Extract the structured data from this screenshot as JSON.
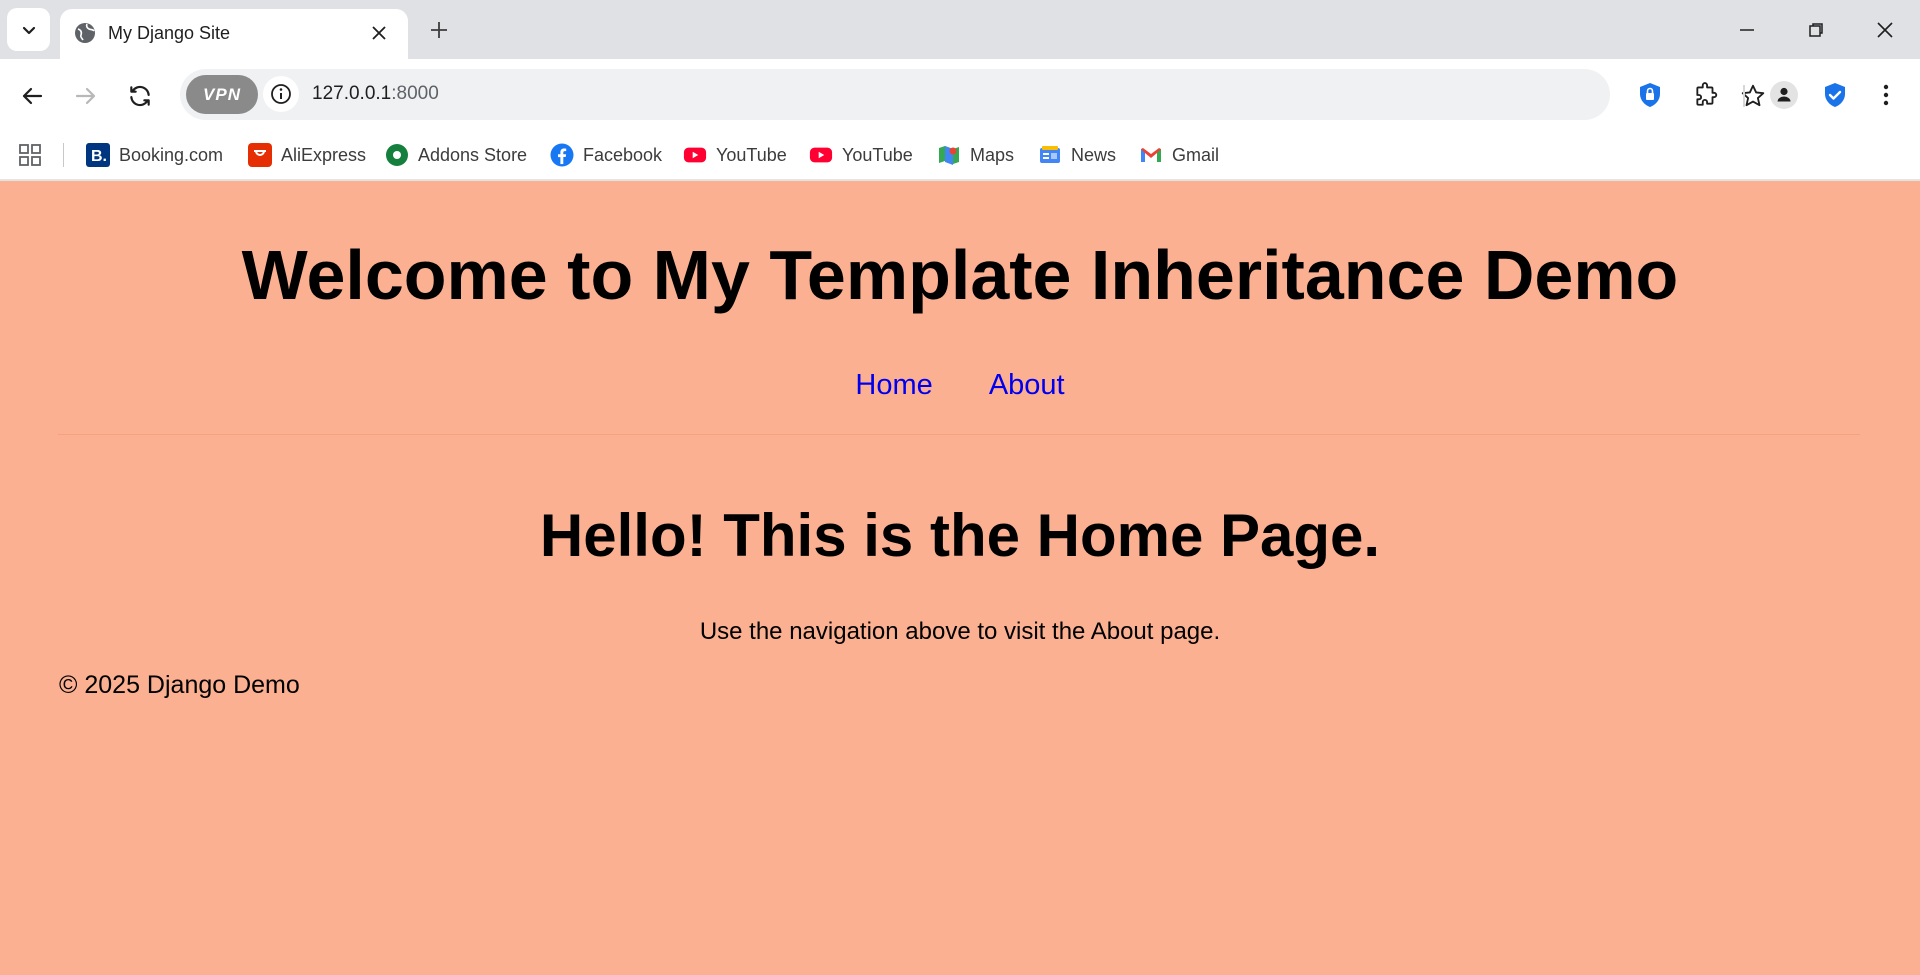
{
  "browser": {
    "tab": {
      "title": "My Django Site"
    },
    "address": {
      "host": "127.0.0.1",
      "port": ":8000"
    },
    "vpn_label": "VPN",
    "bookmarks": [
      {
        "label": "Booking.com",
        "icon": "booking-icon",
        "color": "#003580"
      },
      {
        "label": "AliExpress",
        "icon": "aliexpress-icon",
        "color": "#e62e04"
      },
      {
        "label": "Addons Store",
        "icon": "addons-store-icon",
        "color": "#15803d"
      },
      {
        "label": "Facebook",
        "icon": "facebook-icon",
        "color": "#1877f2"
      },
      {
        "label": "YouTube",
        "icon": "youtube-icon",
        "color": "#ff0033"
      },
      {
        "label": "YouTube",
        "icon": "youtube-icon",
        "color": "#ff0033"
      },
      {
        "label": "Maps",
        "icon": "maps-icon",
        "color": "#34a853"
      },
      {
        "label": "News",
        "icon": "news-icon",
        "color": "#4285f4"
      },
      {
        "label": "Gmail",
        "icon": "gmail-icon",
        "color": "#ea4335"
      }
    ]
  },
  "page": {
    "background": "#fbb091",
    "title": "Welcome to My Template Inheritance Demo",
    "nav": {
      "home": "Home",
      "about": "About"
    },
    "heading": "Hello! This is the Home Page.",
    "text": "Use the navigation above to visit the About page.",
    "footer": "© 2025 Django Demo"
  }
}
